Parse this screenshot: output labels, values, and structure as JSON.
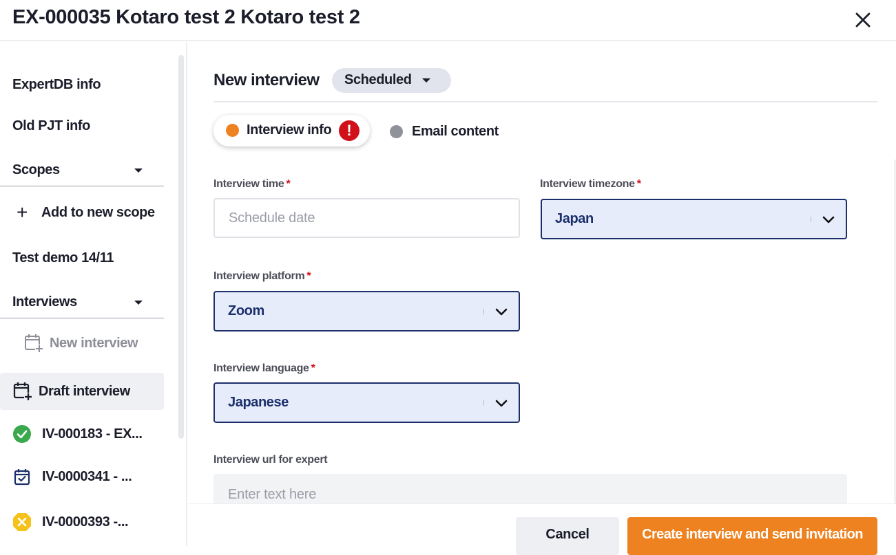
{
  "header": {
    "title": "EX-000035 Kotaro test 2 Kotaro test 2",
    "close_icon": "close-icon"
  },
  "sidebar": {
    "expertdb_info": "ExpertDB info",
    "old_pjt_info": "Old PJT info",
    "scopes": {
      "label": "Scopes",
      "add_label": "Add to new scope",
      "items": [
        "Test demo 14/11"
      ]
    },
    "interviews": {
      "label": "Interviews",
      "new_interview": "New interview",
      "draft_interview": "Draft interview",
      "items": [
        {
          "label": "IV-000183 - EX...",
          "status": "completed",
          "icon": "check-circle-icon",
          "color": "#3aa84c"
        },
        {
          "label": "IV-0000341 - ...",
          "status": "scheduled",
          "icon": "calendar-check-icon",
          "color": "#1b2f6b"
        },
        {
          "label": "IV-0000393 -...",
          "status": "cancelled",
          "icon": "x-circle-icon",
          "color": "#f5c21b"
        }
      ]
    }
  },
  "main": {
    "title": "New interview",
    "status": "Scheduled",
    "tabs": [
      {
        "label": "Interview info",
        "active": true,
        "dot_color": "#ee8220",
        "warning": "!"
      },
      {
        "label": "Email content",
        "active": false,
        "dot_color": "#909299"
      }
    ],
    "fields": {
      "interview_time": {
        "label": "Interview time",
        "required": "*",
        "placeholder": "Schedule date"
      },
      "interview_timezone": {
        "label": "Interview timezone",
        "required": "*",
        "value": "Japan"
      },
      "interview_platform": {
        "label": "Interview platform",
        "required": "*",
        "value": "Zoom"
      },
      "interview_language": {
        "label": "Interview language",
        "required": "*",
        "value": "Japanese"
      },
      "interview_url": {
        "label": "Interview url for expert",
        "placeholder": "Enter text here"
      }
    }
  },
  "footer": {
    "cancel": "Cancel",
    "create": "Create interview and send invitation"
  },
  "colors": {
    "accent": "#ee8220",
    "select_border": "#1b2f6b",
    "select_bg": "#e7ecfb",
    "error": "#d0101a"
  }
}
